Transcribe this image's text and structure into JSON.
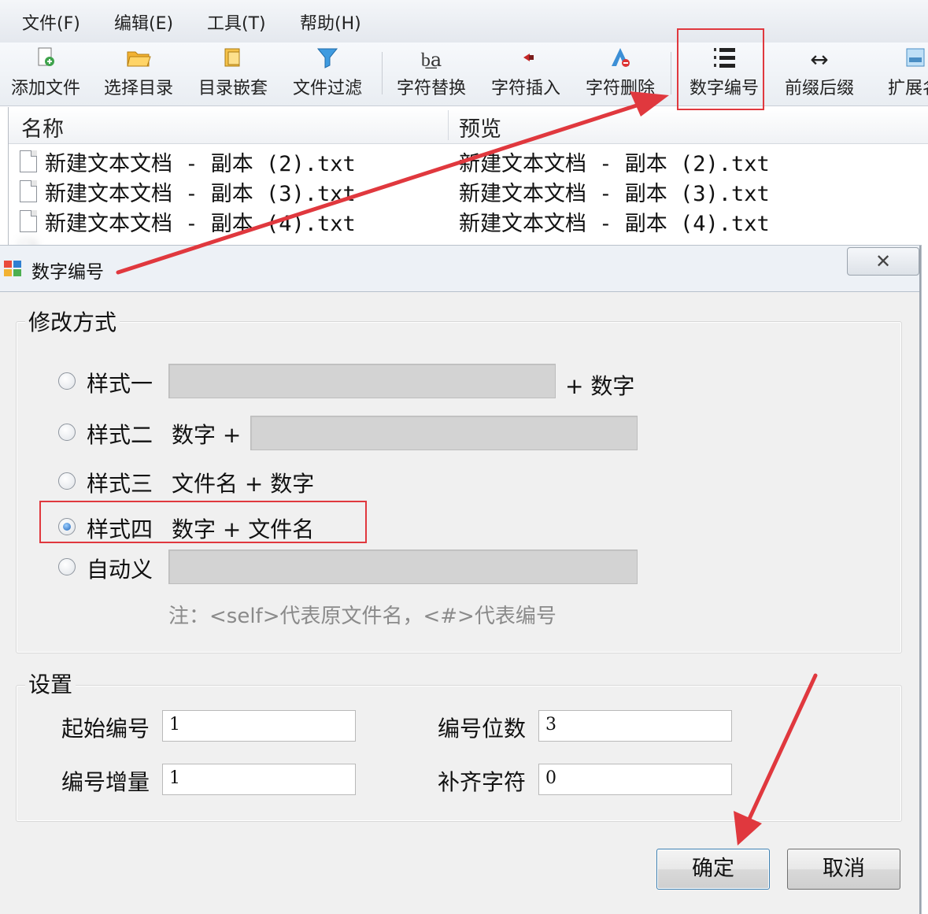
{
  "menubar": {
    "items": [
      "文件(F)",
      "编辑(E)",
      "工具(T)",
      "帮助(H)"
    ]
  },
  "toolbar": {
    "tools": [
      {
        "label": "添加文件",
        "icon": "add-file-icon"
      },
      {
        "label": "选择目录",
        "icon": "open-folder-icon"
      },
      {
        "label": "目录嵌套",
        "icon": "nested-folder-icon"
      },
      {
        "label": "文件过滤",
        "icon": "filter-icon"
      },
      {
        "label": "字符替换",
        "icon": "replace-text-icon"
      },
      {
        "label": "字符插入",
        "icon": "insert-text-icon"
      },
      {
        "label": "字符删除",
        "icon": "delete-text-icon"
      },
      {
        "label": "数字编号",
        "icon": "numbered-list-icon"
      },
      {
        "label": "前缀后缀",
        "icon": "prefix-suffix-icon"
      },
      {
        "label": "扩展名",
        "icon": "extension-icon"
      }
    ]
  },
  "filelist": {
    "columns": [
      "名称",
      "预览"
    ],
    "rows": [
      {
        "name": "新建文本文档 - 副本 (2).txt",
        "preview": "新建文本文档 - 副本 (2).txt"
      },
      {
        "name": "新建文本文档 - 副本 (3).txt",
        "preview": "新建文本文档 - 副本 (3).txt"
      },
      {
        "name": "新建文本文档 - 副本 (4).txt",
        "preview": "新建文本文档 - 副本 (4).txt"
      }
    ]
  },
  "dialog": {
    "title": "数字编号",
    "close_glyph": "✕",
    "mode_group": {
      "legend": "修改方式",
      "options": {
        "style1": {
          "label": "样式一",
          "suffix": "+ 数字",
          "checked": false
        },
        "style2": {
          "label": "样式二",
          "prefix": "数字 +",
          "checked": false
        },
        "style3": {
          "label": "样式三",
          "formula": "文件名 + 数字",
          "checked": false
        },
        "style4": {
          "label": "样式四",
          "formula": "数字 + 文件名",
          "checked": true
        },
        "custom": {
          "label": "自动义",
          "checked": false
        }
      },
      "note": "注：<self>代表原文件名，<#>代表编号"
    },
    "settings_group": {
      "legend": "设置",
      "start_number": {
        "label": "起始编号",
        "value": "1"
      },
      "digits": {
        "label": "编号位数",
        "value": "3"
      },
      "increment": {
        "label": "编号增量",
        "value": "1"
      },
      "pad_char": {
        "label": "补齐字符",
        "value": "0"
      }
    },
    "ok_label": "确定",
    "cancel_label": "取消"
  },
  "colors": {
    "annotation_red": "#e0383e",
    "radio_selected": "#1d63b8"
  }
}
